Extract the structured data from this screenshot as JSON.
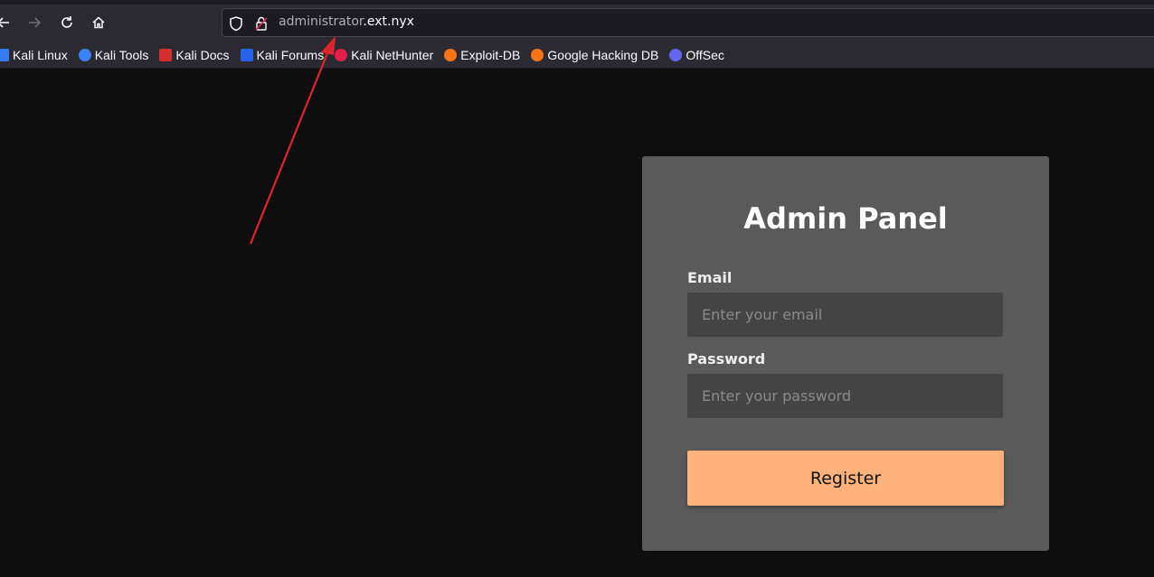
{
  "browser": {
    "url_subdomain": "administrator",
    "url_domain": ".ext.nyx",
    "bookmarks": [
      {
        "label": "Kali Linux",
        "icon": "kali-dragon-icon",
        "color": "#367bf0"
      },
      {
        "label": "Kali Tools",
        "icon": "kali-tools-icon",
        "color": "#3b82f6"
      },
      {
        "label": "Kali Docs",
        "icon": "kali-docs-icon",
        "color": "#d32f2f"
      },
      {
        "label": "Kali Forums",
        "icon": "kali-forums-icon",
        "color": "#2563eb"
      },
      {
        "label": "Kali NetHunter",
        "icon": "kali-nethunter-icon",
        "color": "#e11d48"
      },
      {
        "label": "Exploit-DB",
        "icon": "exploit-db-icon",
        "color": "#f97316"
      },
      {
        "label": "Google Hacking DB",
        "icon": "ghdb-icon",
        "color": "#f97316"
      },
      {
        "label": "OffSec",
        "icon": "offsec-icon",
        "color": "#6366f1"
      }
    ]
  },
  "panel": {
    "title": "Admin Panel",
    "email_label": "Email",
    "email_placeholder": "Enter your email",
    "password_label": "Password",
    "password_placeholder": "Enter your password",
    "submit_label": "Register"
  },
  "colors": {
    "background": "#0e0e0e",
    "panel": "#5a5a5a",
    "input": "#444444",
    "button": "#ffb27c",
    "annotation_arrow": "#e0242b"
  }
}
